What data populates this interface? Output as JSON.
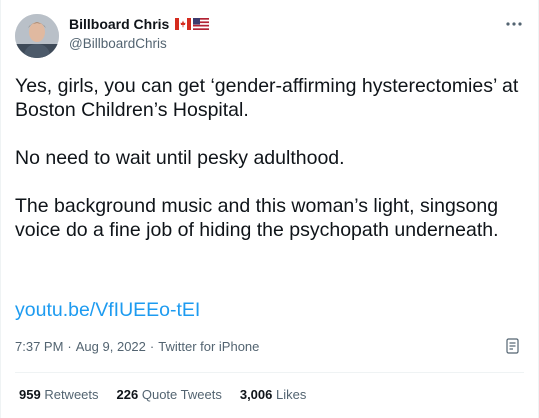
{
  "author": {
    "name": "Billboard Chris",
    "handle": "@BillboardChris",
    "flags": [
      "canada-flag-icon",
      "us-flag-icon"
    ]
  },
  "tweet": {
    "paragraphs": [
      "Yes, girls, you can get ‘gender-affirming hysterectomies’ at Boston Children’s Hospital.",
      "No need to wait until pesky adulthood.",
      "The background music and this woman’s light, singsong voice do a fine job of hiding the psychopath underneath."
    ],
    "link": "youtu.be/VfIUEEo-tEI"
  },
  "meta": {
    "time": "7:37 PM",
    "sep1": "·",
    "date": "Aug 9, 2022",
    "sep2": "·",
    "source": "Twitter for iPhone"
  },
  "stats": {
    "retweets_count": "959",
    "retweets_label": "Retweets",
    "quotes_count": "226",
    "quotes_label": "Quote Tweets",
    "likes_count": "3,006",
    "likes_label": "Likes"
  },
  "colors": {
    "link": "#1d9bf0",
    "secondary_text": "#536471",
    "primary_text": "#0f1419"
  }
}
